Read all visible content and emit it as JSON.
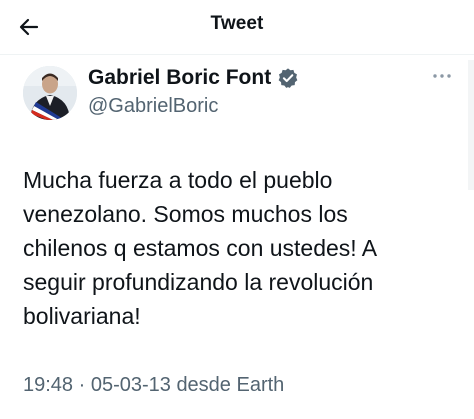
{
  "header": {
    "title": "Tweet"
  },
  "tweet": {
    "author_name": "Gabriel Boric Font",
    "author_handle": "@GabrielBoric",
    "text": "Mucha fuerza a todo el pueblo\nvenezolano. Somos muchos los\nchilenos q estamos con ustedes! A\nseguir profundizando la revolución\nbolivariana!",
    "meta": "19:48 · 05-03-13 desde Earth"
  },
  "icons": {
    "back": "back-arrow-icon",
    "verified": "verified-badge-icon",
    "more": "more-dots-icon"
  },
  "colors": {
    "text": "#0f1419",
    "secondary": "#536471",
    "verified": "#1d9bf0",
    "sash_red": "#d52b1e",
    "sash_blue": "#1f3a93"
  }
}
